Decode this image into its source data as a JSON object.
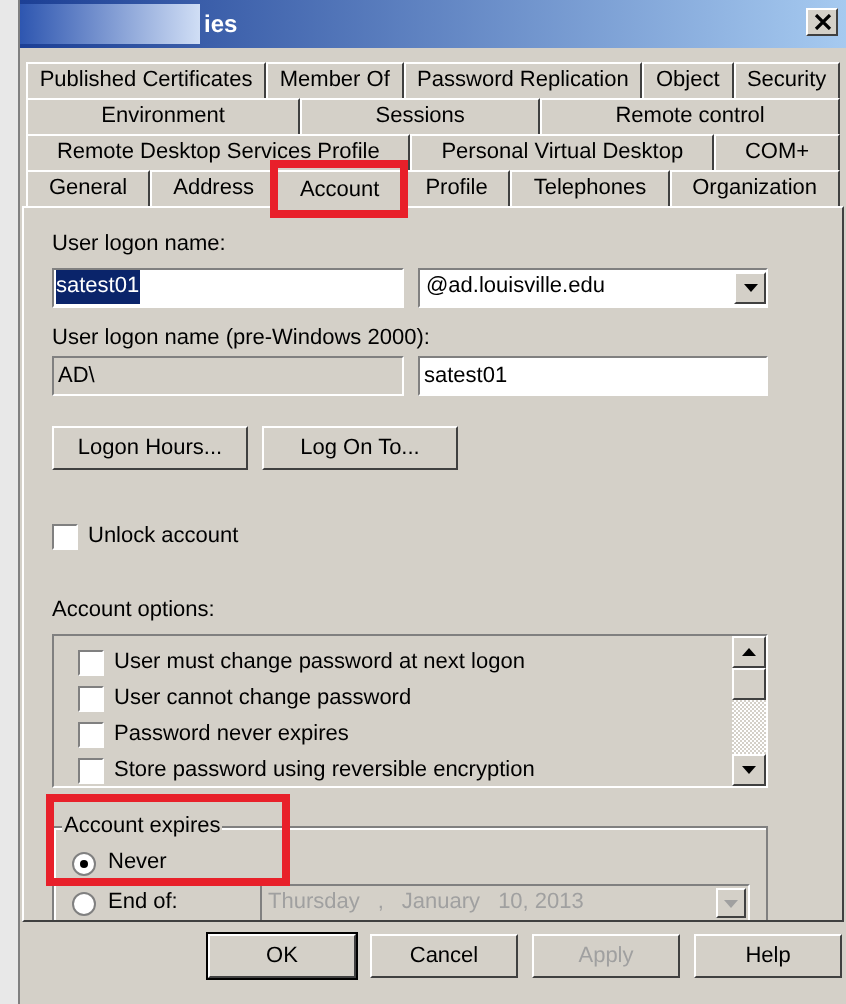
{
  "window": {
    "title": "ies"
  },
  "tab_rows": [
    [
      {
        "label": "Published Certificates",
        "selected": false,
        "highlighted": false
      },
      {
        "label": "Member Of",
        "selected": false,
        "highlighted": false
      },
      {
        "label": "Password Replication",
        "selected": false,
        "highlighted": false
      },
      {
        "label": "Object",
        "selected": false,
        "highlighted": false
      },
      {
        "label": "Security",
        "selected": false,
        "highlighted": false
      }
    ],
    [
      {
        "label": "Environment",
        "selected": false,
        "highlighted": false
      },
      {
        "label": "Sessions",
        "selected": false,
        "highlighted": false
      },
      {
        "label": "Remote control",
        "selected": false,
        "highlighted": false
      }
    ],
    [
      {
        "label": "Remote Desktop Services Profile",
        "selected": false,
        "highlighted": false
      },
      {
        "label": "Personal Virtual Desktop",
        "selected": false,
        "highlighted": false
      },
      {
        "label": "COM+",
        "selected": false,
        "highlighted": false
      }
    ],
    [
      {
        "label": "General",
        "selected": false,
        "highlighted": false
      },
      {
        "label": "Address",
        "selected": false,
        "highlighted": false
      },
      {
        "label": "Account",
        "selected": true,
        "highlighted": true
      },
      {
        "label": "Profile",
        "selected": false,
        "highlighted": false
      },
      {
        "label": "Telephones",
        "selected": false,
        "highlighted": false
      },
      {
        "label": "Organization",
        "selected": false,
        "highlighted": false
      }
    ]
  ],
  "logon_name": {
    "label": "User logon name:",
    "value": "satest01",
    "value_selected": true,
    "domain": "@ad.louisville.edu"
  },
  "pre2000": {
    "label": "User logon name (pre-Windows 2000):",
    "domain": "AD\\",
    "value": "satest01"
  },
  "buttons": [
    "Logon Hours...",
    "Log On To..."
  ],
  "unlock": {
    "label": "Unlock account",
    "checked": false
  },
  "options": {
    "label": "Account options:",
    "items": [
      {
        "label": "User must change password at next logon",
        "checked": false
      },
      {
        "label": "User cannot change password",
        "checked": false
      },
      {
        "label": "Password never expires",
        "checked": false
      },
      {
        "label": "Store password using reversible encryption",
        "checked": false
      }
    ]
  },
  "expires": {
    "label": "Account expires",
    "highlighted": true,
    "choices": [
      {
        "label": "Never",
        "selected": true
      },
      {
        "label": "End of:",
        "selected": false
      }
    ],
    "date": {
      "parts": [
        "Thursday",
        ",",
        "January",
        "10, 2013"
      ],
      "disabled": true
    }
  },
  "footer_buttons": [
    {
      "label": "OK",
      "disabled": false,
      "default": true
    },
    {
      "label": "Cancel",
      "disabled": false,
      "default": false
    },
    {
      "label": "Apply",
      "disabled": true,
      "default": false
    },
    {
      "label": "Help",
      "disabled": false,
      "default": false
    }
  ]
}
